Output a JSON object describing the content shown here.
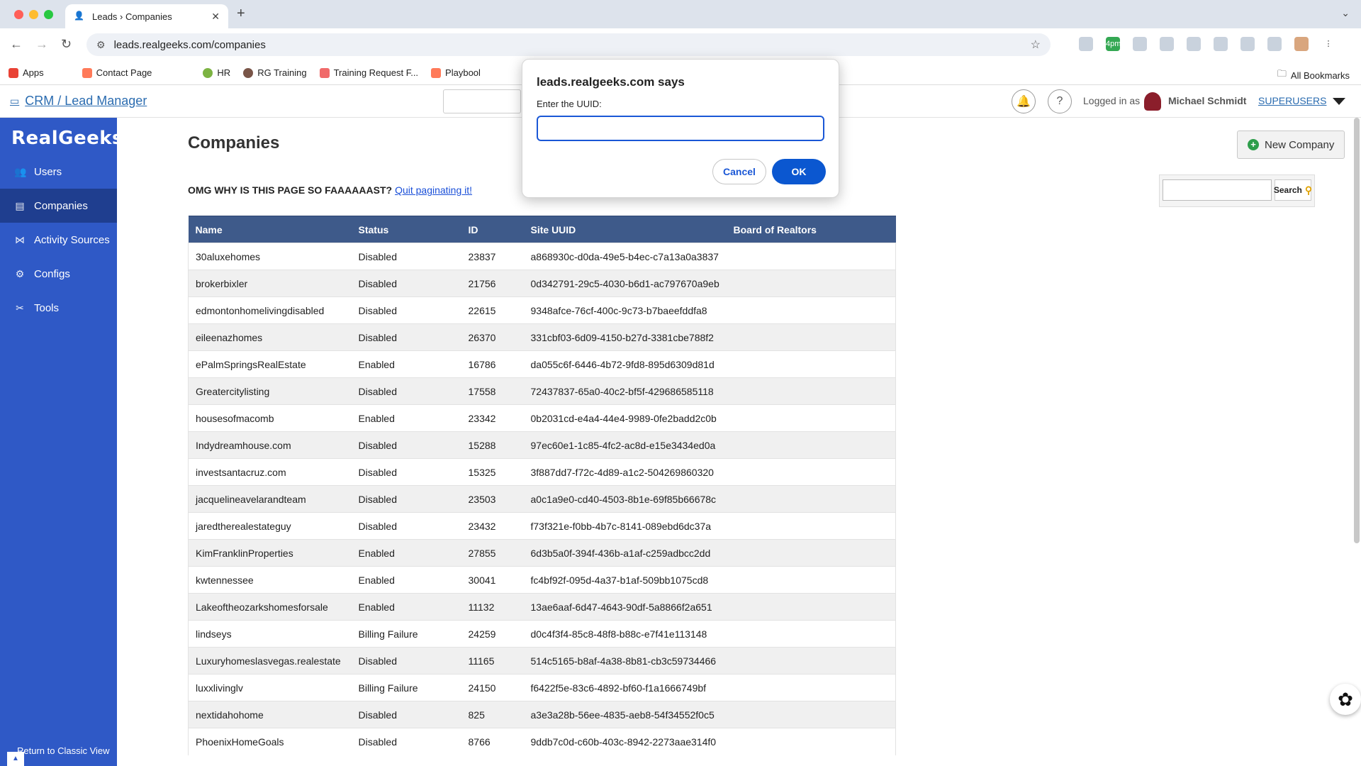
{
  "browser": {
    "tab_title": "Leads › Companies",
    "url": "leads.realgeeks.com/companies",
    "all_bookmarks": "All Bookmarks",
    "ext_badge": "4pm"
  },
  "bookmarks": [
    "Apps",
    "Contact Page",
    "HR",
    "RG Training",
    "Training Request F...",
    "Playbool"
  ],
  "header": {
    "crm_link": "CRM / Lead Manager",
    "logged_in_as": "Logged in as",
    "user_name": "Michael Schmidt",
    "group": "SUPERUSERS"
  },
  "sidebar": {
    "logo": "RealGeeks",
    "items": [
      {
        "label": "Users",
        "icon": "users-icon"
      },
      {
        "label": "Companies",
        "icon": "building-icon"
      },
      {
        "label": "Activity Sources",
        "icon": "share-icon"
      },
      {
        "label": "Configs",
        "icon": "gear-icon"
      },
      {
        "label": "Tools",
        "icon": "tools-icon"
      }
    ],
    "classic_view": "Return to Classic View"
  },
  "main": {
    "title": "Companies",
    "notice_text": "OMG WHY IS THIS PAGE SO FAAAAAAST?",
    "notice_link": "Quit paginating it!",
    "new_company": "New Company",
    "search_button": "Search"
  },
  "table": {
    "headers": [
      "Name",
      "Status",
      "ID",
      "Site UUID",
      "Board of Realtors"
    ],
    "rows": [
      [
        "30aluxehomes",
        "Disabled",
        "23837",
        "a868930c-d0da-49e5-b4ec-c7a13a0a3837",
        ""
      ],
      [
        "brokerbixler",
        "Disabled",
        "21756",
        "0d342791-29c5-4030-b6d1-ac797670a9eb",
        ""
      ],
      [
        "edmontonhomelivingdisabled",
        "Disabled",
        "22615",
        "9348afce-76cf-400c-9c73-b7baeefddfa8",
        ""
      ],
      [
        "eileenazhomes",
        "Disabled",
        "26370",
        "331cbf03-6d09-4150-b27d-3381cbe788f2",
        ""
      ],
      [
        "ePalmSpringsRealEstate",
        "Enabled",
        "16786",
        "da055c6f-6446-4b72-9fd8-895d6309d81d",
        ""
      ],
      [
        "Greatercitylisting",
        "Disabled",
        "17558",
        "72437837-65a0-40c2-bf5f-429686585118",
        ""
      ],
      [
        "housesofmacomb",
        "Enabled",
        "23342",
        "0b2031cd-e4a4-44e4-9989-0fe2badd2c0b",
        ""
      ],
      [
        "Indydreamhouse.com",
        "Disabled",
        "15288",
        "97ec60e1-1c85-4fc2-ac8d-e15e3434ed0a",
        ""
      ],
      [
        "investsantacruz.com",
        "Disabled",
        "15325",
        "3f887dd7-f72c-4d89-a1c2-504269860320",
        ""
      ],
      [
        "jacquelineavelarandteam",
        "Disabled",
        "23503",
        "a0c1a9e0-cd40-4503-8b1e-69f85b66678c",
        ""
      ],
      [
        "jaredtherealestateguy",
        "Disabled",
        "23432",
        "f73f321e-f0bb-4b7c-8141-089ebd6dc37a",
        ""
      ],
      [
        "KimFranklinProperties",
        "Enabled",
        "27855",
        "6d3b5a0f-394f-436b-a1af-c259adbcc2dd",
        ""
      ],
      [
        "kwtennessee",
        "Enabled",
        "30041",
        "fc4bf92f-095d-4a37-b1af-509bb1075cd8",
        ""
      ],
      [
        "Lakeoftheozarkshomesforsale",
        "Enabled",
        "11132",
        "13ae6aaf-6d47-4643-90df-5a8866f2a651",
        ""
      ],
      [
        "lindseys",
        "Billing Failure",
        "24259",
        "d0c4f3f4-85c8-48f8-b88c-e7f41e113148",
        ""
      ],
      [
        "Luxuryhomeslasvegas.realestate",
        "Disabled",
        "11165",
        "514c5165-b8af-4a38-8b81-cb3c59734466",
        ""
      ],
      [
        "luxxlivinglv",
        "Billing Failure",
        "24150",
        "f6422f5e-83c6-4892-bf60-f1a1666749bf",
        ""
      ],
      [
        "nextidahohome",
        "Disabled",
        "825",
        "a3e3a28b-56ee-4835-aeb8-54f34552f0c5",
        ""
      ],
      [
        "PhoenixHomeGoals",
        "Disabled",
        "8766",
        "9ddb7c0d-c60b-403c-8942-2273aae314f0",
        ""
      ]
    ]
  },
  "dialog": {
    "title": "leads.realgeeks.com says",
    "prompt": "Enter the UUID:",
    "value": "",
    "cancel": "Cancel",
    "ok": "OK"
  },
  "colors": {
    "sidebar": "#2f59c6",
    "sidebar_active": "#1f3e8f",
    "table_header": "#3e5a8a",
    "ok_button": "#0b57d0"
  }
}
